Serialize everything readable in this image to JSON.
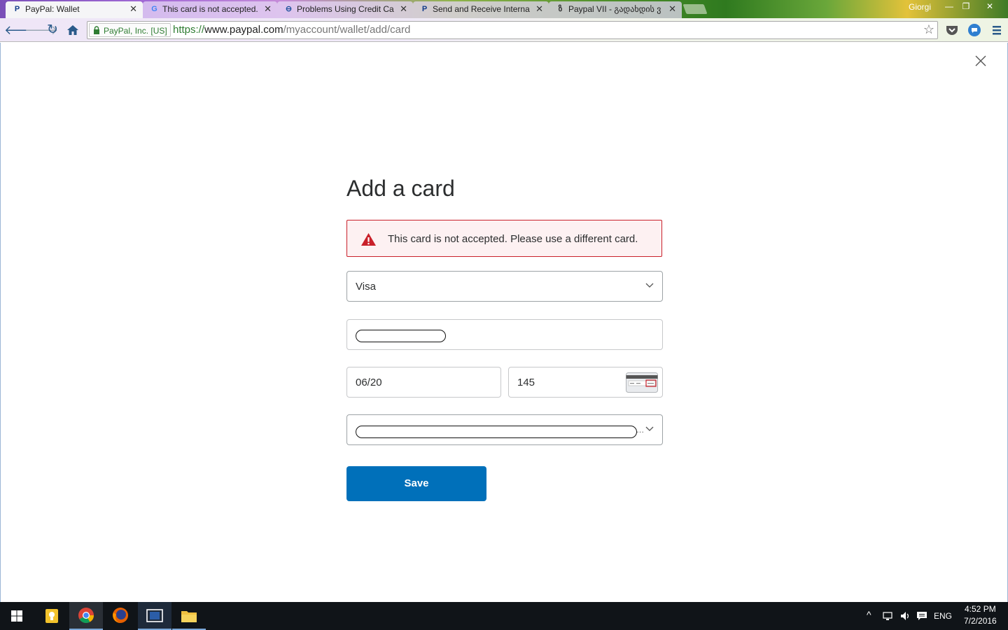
{
  "browser": {
    "tabs": [
      {
        "title": "PayPal: Wallet",
        "icon": "paypal-icon",
        "active": true
      },
      {
        "title": "This card is not accepted.",
        "icon": "google-icon",
        "active": false
      },
      {
        "title": "Problems Using Credit Ca",
        "icon": "forum-icon",
        "active": false
      },
      {
        "title": "Send and Receive Interna",
        "icon": "paypal-icon",
        "active": false
      },
      {
        "title": "Paypal VII - გადახდის ვ",
        "icon": "site-icon",
        "active": false
      }
    ],
    "profile_name": "Giorgi",
    "window_controls": {
      "minimize": "—",
      "restore": "❐",
      "close": "✕"
    },
    "security_badge": "PayPal, Inc. [US]",
    "url": {
      "scheme": "https://",
      "host": "www.paypal.com",
      "path": "/myaccount/wallet/add/card"
    }
  },
  "page": {
    "title": "Add a card",
    "alert": {
      "message": "This card is not accepted. Please use a different card.",
      "icon": "warning-icon",
      "color": "#c9202a"
    },
    "card_type": {
      "value": "Visa"
    },
    "card_number": {
      "value": ""
    },
    "expiration": {
      "value": "06/20"
    },
    "csc": {
      "value": "145",
      "icon": "card-back-icon"
    },
    "billing_address": {
      "value": "",
      "ellipsis": "..."
    },
    "save_label": "Save",
    "accent_color": "#0070ba"
  },
  "taskbar": {
    "items": [
      "start-button",
      "tips-app",
      "chrome",
      "firefox",
      "media-app",
      "file-explorer"
    ],
    "language": "ENG",
    "time": "4:52 PM",
    "date": "7/2/2016"
  }
}
